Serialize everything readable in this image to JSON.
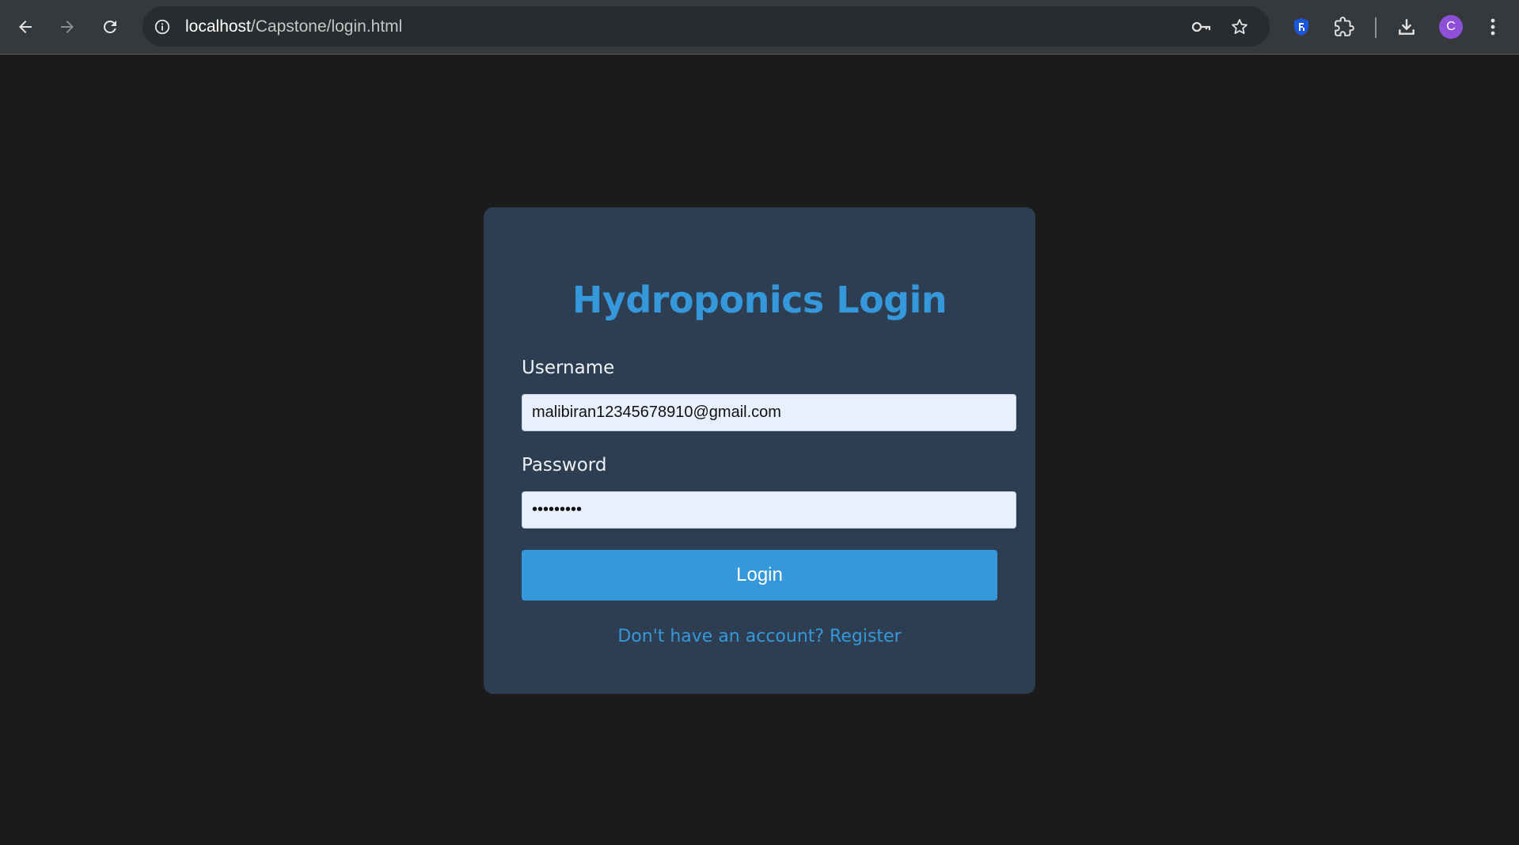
{
  "browser": {
    "url_host": "localhost",
    "url_path": "/Capstone/login.html",
    "avatar_initial": "C",
    "icons": [
      "back-arrow-icon",
      "forward-arrow-icon",
      "reload-icon",
      "site-info-icon",
      "password-key-icon",
      "bookmark-star-icon",
      "extension-shield-icon",
      "extensions-puzzle-icon",
      "download-icon",
      "kebab-menu-icon"
    ]
  },
  "login": {
    "title": "Hydroponics Login",
    "username_label": "Username",
    "username_value": "malibiran12345678910@gmail.com",
    "password_label": "Password",
    "password_value": "123456789",
    "submit_label": "Login",
    "register_text": "Don't have an account? Register"
  },
  "colors": {
    "page_background": "#1b1b1b",
    "card_background": "#2d3e52",
    "accent": "#3498db",
    "input_background": "#e8f0fe"
  }
}
